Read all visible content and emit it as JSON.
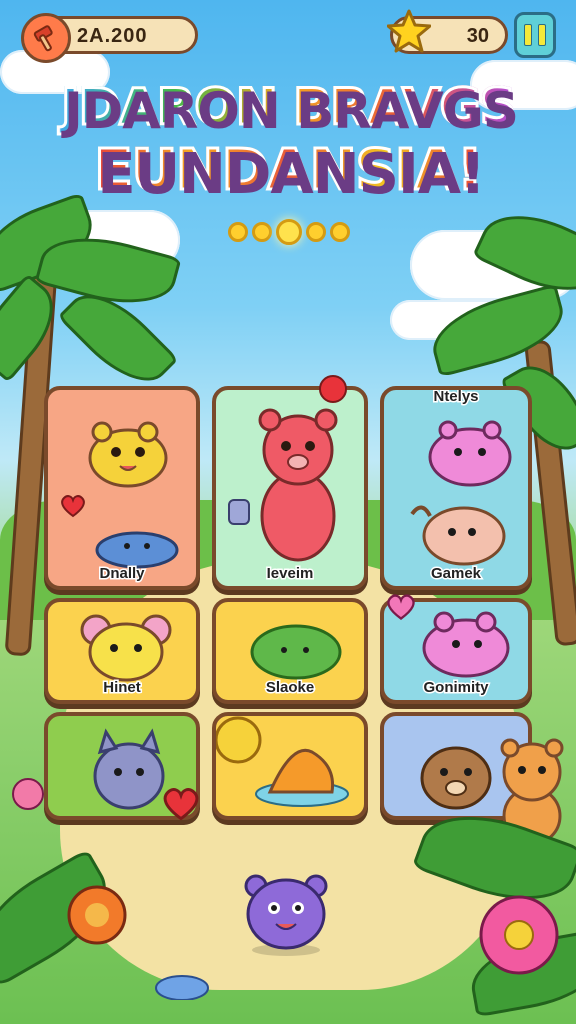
{
  "hud": {
    "coins": "2A.200",
    "stars": "30",
    "pause_icon": "pause-icon",
    "coin_icon": "hammer-icon",
    "star_icon": "star-icon"
  },
  "title": {
    "line1": "JDARON BRAVGS",
    "line2": "EUNDANSIA!"
  },
  "page_indicator": {
    "count": 5,
    "active": 3
  },
  "cards": [
    {
      "label": "Dnally"
    },
    {
      "label": "Ieveim"
    },
    {
      "label": "Gamek",
      "top_label": "Ntelys"
    },
    {
      "label": "Hinet"
    },
    {
      "label": "Slaoke"
    },
    {
      "label": "Gonimity"
    },
    {
      "label": ""
    },
    {
      "label": ""
    },
    {
      "label": ""
    }
  ],
  "colors": {
    "sky": "#4fb6ef",
    "card_orange": "#f7a685",
    "card_mint": "#bdf0cc",
    "card_teal": "#8fd9e6",
    "card_yellow": "#fbd24e",
    "card_green": "#8fcd4e",
    "card_blue": "#a9c5ef",
    "border": "#7a4a2b"
  }
}
